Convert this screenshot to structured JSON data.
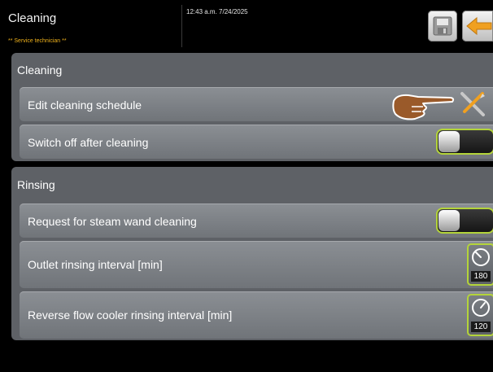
{
  "header": {
    "title": "Cleaning",
    "user_role": "** Service technician **",
    "datetime": "12:43 a.m. 7/24/2025"
  },
  "section_cleaning": {
    "title": "Cleaning",
    "edit_schedule_label": "Edit cleaning schedule",
    "switch_off_label": "Switch off after cleaning",
    "switch_off_state": "off"
  },
  "section_rinsing": {
    "title": "Rinsing",
    "steam_wand_label": "Request for steam wand cleaning",
    "steam_wand_state": "off",
    "outlet_label": "Outlet rinsing interval [min]",
    "outlet_value": "180",
    "reverse_label": "Reverse flow cooler rinsing interval [min]",
    "reverse_value": "120"
  },
  "colors": {
    "accent_orange": "#f0a020",
    "toggle_border": "#b4d43a",
    "panel_bg": "#5e6166"
  },
  "icons": [
    "save-icon",
    "back-arrow-icon",
    "pointing-hand-icon",
    "tools-icon",
    "gauge-icon"
  ]
}
